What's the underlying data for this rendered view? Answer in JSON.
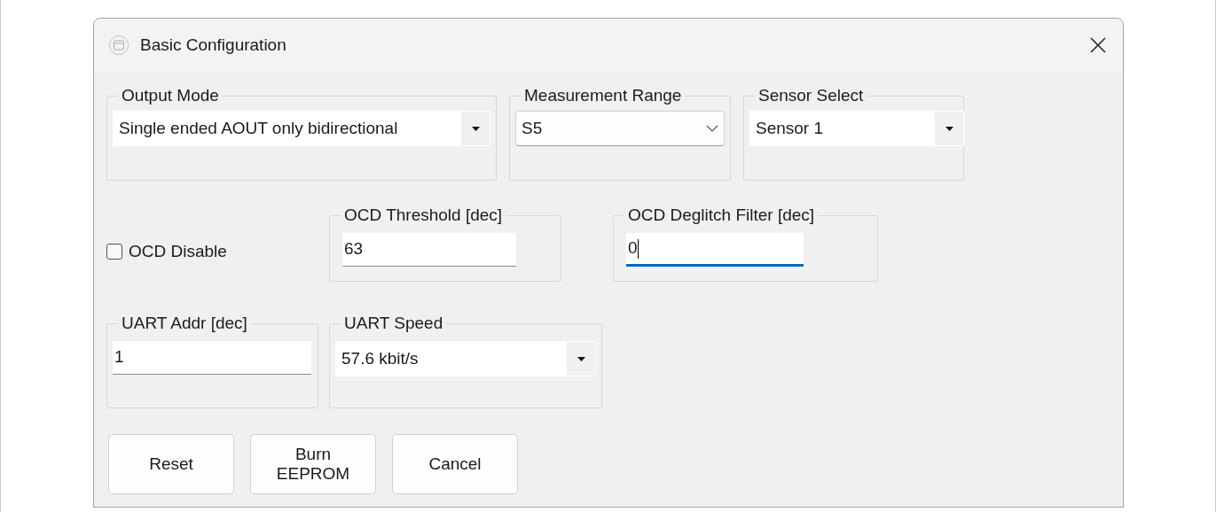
{
  "window": {
    "title": "Basic Configuration"
  },
  "row_1": [
    {
      "label": "Output Mode",
      "kind": "dropdown",
      "value": "Single ended AOUT only bidirectional"
    },
    {
      "label": "Measurement Range",
      "kind": "combo",
      "value": "S5"
    },
    {
      "label": "Sensor Select",
      "kind": "dropdown",
      "value": "Sensor 1"
    }
  ],
  "ocd_disable": {
    "label": "OCD Disable",
    "checked": false
  },
  "row_2": [
    {
      "label": "OCD Threshold [dec]",
      "kind": "text",
      "value": "63",
      "focused": false
    },
    {
      "label": "OCD Deglitch Filter [dec]",
      "kind": "text",
      "value": "0",
      "focused": true
    }
  ],
  "row_3": [
    {
      "label": "UART Addr [dec]",
      "kind": "text",
      "value": "1",
      "focused": false
    },
    {
      "label": "UART Speed",
      "kind": "dropdown",
      "value": "57.6 kbit/s"
    }
  ],
  "buttons": [
    "Reset",
    "Burn\nEEPROM",
    "Cancel"
  ]
}
